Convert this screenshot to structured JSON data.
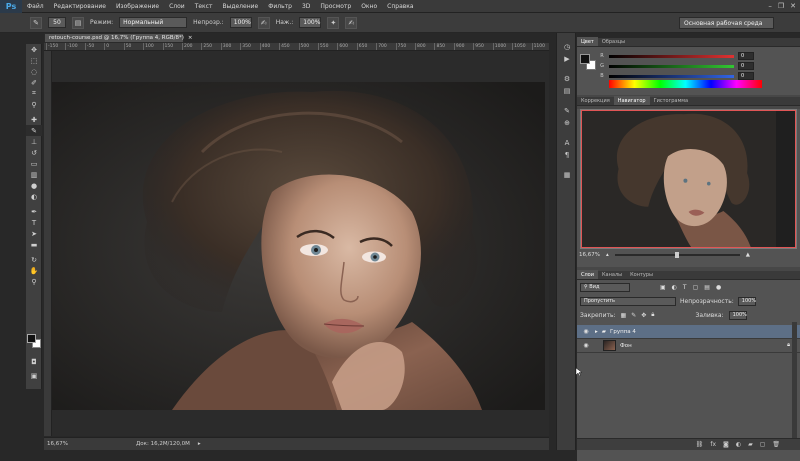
{
  "app": {
    "logo": "Ps"
  },
  "menu": [
    "Файл",
    "Редактирование",
    "Изображение",
    "Слои",
    "Текст",
    "Выделение",
    "Фильтр",
    "3D",
    "Просмотр",
    "Окно",
    "Справка"
  ],
  "window_controls": [
    "–",
    "❐",
    "✕"
  ],
  "options_bar": {
    "mode_label": "Режим:",
    "mode_value": "Нормальный",
    "opacity_label": "Непрозр.:",
    "opacity_value": "100%",
    "flow_label": "Наж.:",
    "flow_value": "100%",
    "brush_size": "50",
    "workspace": "Основная рабочая среда"
  },
  "document": {
    "tab_title": "retouch-course.psd @ 16,7% (Группа 4, RGB/8*)",
    "close_glyph": "×",
    "ruler_ticks": [
      "-150",
      "-100",
      "-50",
      "0",
      "50",
      "100",
      "150",
      "200",
      "250",
      "300",
      "350",
      "400",
      "450",
      "500",
      "550",
      "600",
      "650",
      "700",
      "750",
      "800",
      "850",
      "900",
      "950",
      "1000",
      "1050",
      "1100"
    ],
    "zoom": "16,67%",
    "doc_size": "Док: 16,2M/120,0M"
  },
  "color_panel": {
    "tabs": [
      "Цвет",
      "Образцы"
    ],
    "channels": [
      {
        "label": "R",
        "value": "0",
        "color": "#e03232"
      },
      {
        "label": "G",
        "value": "0",
        "color": "#32c832"
      },
      {
        "label": "B",
        "value": "0",
        "color": "#3264e6"
      }
    ]
  },
  "navigator_panel": {
    "tabs": [
      "Коррекция",
      "Навигатор",
      "Гистограмма"
    ],
    "zoom": "16,67%",
    "view_box_color": "#e05555"
  },
  "layers_panel": {
    "tabs": [
      "Слои",
      "Каналы",
      "Контуры"
    ],
    "filter": "Вид",
    "blend_mode": "Пропустить",
    "opacity_label": "Непрозрачность:",
    "opacity_value": "100%",
    "lock_label": "Закрепить:",
    "fill_label": "Заливка:",
    "fill_value": "100%",
    "layers": [
      {
        "name": "Группа 4",
        "type": "group",
        "selected": true
      },
      {
        "name": "Фон",
        "type": "background",
        "selected": false
      }
    ]
  },
  "colors": {
    "accent_select": "#5d6f86",
    "nav_frame": "#e05555",
    "fg": "#111111",
    "bg": "#ffffff"
  }
}
